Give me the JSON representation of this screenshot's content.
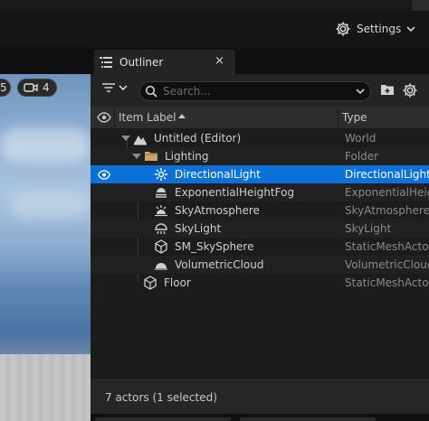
{
  "toolbar": {
    "settings_label": "Settings"
  },
  "viewport": {
    "badge_left": "5",
    "camera_speed": "4"
  },
  "outliner": {
    "tab_title": "Outliner",
    "close_glyph": "×",
    "search_placeholder": "Search...",
    "columns": {
      "label": "Item Label",
      "type": "Type"
    },
    "rows": [
      {
        "name": "Untitled (Editor)",
        "type": "World",
        "icon": "world-icon"
      },
      {
        "name": "Lighting",
        "type": "Folder",
        "icon": "folder-icon"
      },
      {
        "name": "DirectionalLight",
        "type": "DirectionalLight",
        "icon": "directional-light-icon"
      },
      {
        "name": "ExponentialHeightFog",
        "type": "ExponentialHeigh",
        "icon": "height-fog-icon"
      },
      {
        "name": "SkyAtmosphere",
        "type": "SkyAtmosphere",
        "icon": "sky-atmosphere-icon"
      },
      {
        "name": "SkyLight",
        "type": "SkyLight",
        "icon": "sky-light-icon"
      },
      {
        "name": "SM_SkySphere",
        "type": "StaticMeshActo",
        "icon": "static-mesh-icon"
      },
      {
        "name": "VolumetricCloud",
        "type": "VolumetricClouc",
        "icon": "volumetric-cloud-icon"
      },
      {
        "name": "Floor",
        "type": "StaticMeshActo",
        "icon": "static-mesh-icon"
      }
    ],
    "status": "7 actors (1 selected)"
  },
  "colors": {
    "selection": "#0b70d8",
    "panel": "#1c1c1c",
    "folder": "#c8a76a"
  }
}
